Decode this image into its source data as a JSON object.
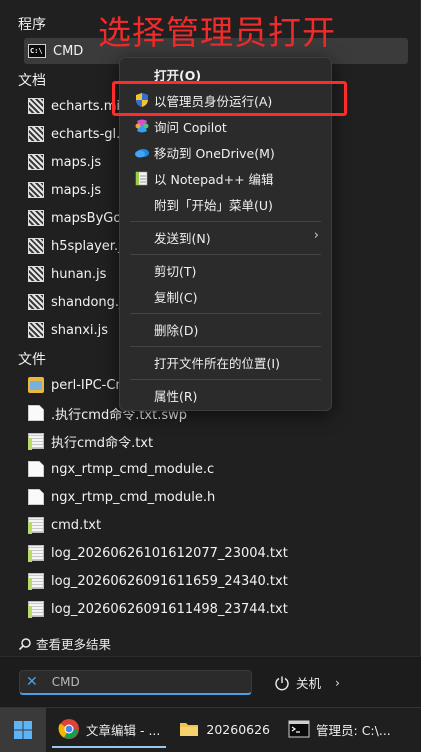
{
  "banner": "选择管理员打开",
  "sections": {
    "programs": "程序",
    "documents": "文档",
    "files": "文件"
  },
  "programs": [
    {
      "label": "CMD"
    }
  ],
  "documents": [
    {
      "label": "echarts.mi"
    },
    {
      "label": "echarts-gl.m"
    },
    {
      "label": "maps.js"
    },
    {
      "label": "maps.js"
    },
    {
      "label": "mapsByGoo"
    },
    {
      "label": "h5splayer.js"
    },
    {
      "label": "hunan.js"
    },
    {
      "label": "shandong.js"
    },
    {
      "label": "shanxi.js"
    }
  ],
  "files": [
    {
      "label": "perl-IPC-Cm"
    },
    {
      "label": ".执行cmd命令.txt.swp"
    },
    {
      "label": "执行cmd命令.txt"
    },
    {
      "label": "ngx_rtmp_cmd_module.c"
    },
    {
      "label": "ngx_rtmp_cmd_module.h"
    },
    {
      "label": "cmd.txt"
    },
    {
      "label": "log_20260626101612077_23004.txt"
    },
    {
      "label": "log_20260626091611659_24340.txt"
    },
    {
      "label": "log_20260626091611498_23744.txt"
    }
  ],
  "context_menu": {
    "open": "打开(O)",
    "run_as_admin": "以管理员身份运行(A)",
    "ask_copilot": "询问 Copilot",
    "move_onedrive": "移动到 OneDrive(M)",
    "edit_notepad": "以 Notepad++ 编辑",
    "pin_start": "附到「开始」菜单(U)",
    "send_to": "发送到(N)",
    "cut": "剪切(T)",
    "copy": "复制(C)",
    "delete": "删除(D)",
    "open_location": "打开文件所在的位置(I)",
    "properties": "属性(R)"
  },
  "more_results": "查看更多结果",
  "search": {
    "value": "CMD"
  },
  "power": {
    "label": "关机"
  },
  "taskbar": {
    "chrome": "文章编辑 - ...",
    "folder": "20260626",
    "cmd": "管理员: C:\\..."
  },
  "colors": {
    "accent": "#4aa0e6",
    "highlight_box": "#ff2a2a",
    "banner": "#ef2b2b"
  }
}
